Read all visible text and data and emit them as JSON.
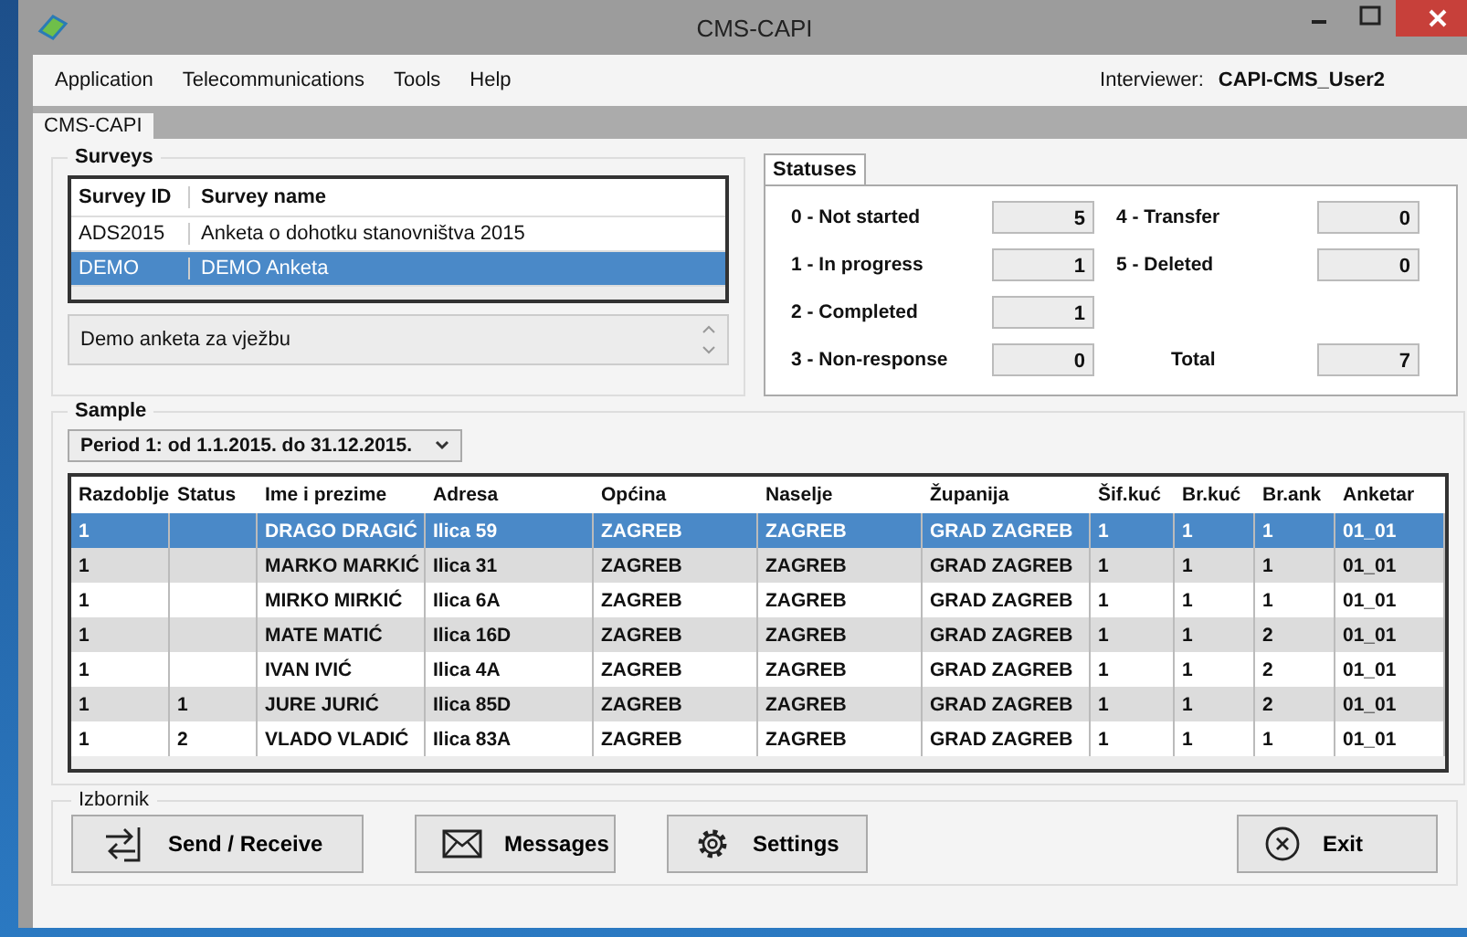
{
  "window": {
    "title": "CMS-CAPI"
  },
  "menu": [
    "Application",
    "Telecommunications",
    "Tools",
    "Help"
  ],
  "interviewer": {
    "label": "Interviewer:",
    "value": "CAPI-CMS_User2"
  },
  "tabs": [
    {
      "label": "CMS-CAPI",
      "selected": true
    }
  ],
  "surveys": {
    "title": "Surveys",
    "columns": [
      "Survey ID",
      "Survey name"
    ],
    "rows": [
      {
        "id": "ADS2015",
        "name": "Anketa o dohotku stanovništva 2015",
        "selected": false
      },
      {
        "id": "DEMO",
        "name": "DEMO Anketa",
        "selected": true
      }
    ],
    "description": "Demo anketa za vježbu"
  },
  "statuses": {
    "tab": "Statuses",
    "items": [
      {
        "label": "0 - Not started",
        "value": "5"
      },
      {
        "label": "4 - Transfer",
        "value": "0"
      },
      {
        "label": "1 - In progress",
        "value": "1"
      },
      {
        "label": "5 - Deleted",
        "value": "0"
      },
      {
        "label": "2 - Completed",
        "value": "1"
      },
      {
        "kind": "blank"
      },
      {
        "label": "3 - Non-response",
        "value": "0"
      },
      {
        "label": "Total",
        "value": "7",
        "kind": "total"
      }
    ]
  },
  "sample": {
    "title": "Sample",
    "period": "Period 1:  od 1.1.2015. do 31.12.2015.",
    "columns": [
      "Razdoblje",
      "Status",
      "Ime i prezime",
      "Adresa",
      "Općina",
      "Naselje",
      "Županija",
      "Šif.kuć",
      "Br.kuć",
      "Br.ank",
      "Anketar"
    ],
    "rows": [
      {
        "cells": [
          "1",
          "",
          "DRAGO DRAGIĆ",
          "Ilica 59",
          "ZAGREB",
          "ZAGREB",
          "GRAD ZAGREB",
          "1",
          "1",
          "1",
          "01_01"
        ],
        "selected": true
      },
      {
        "cells": [
          "1",
          "",
          "MARKO MARKIĆ",
          "Ilica 31",
          "ZAGREB",
          "ZAGREB",
          "GRAD ZAGREB",
          "1",
          "1",
          "1",
          "01_01"
        ],
        "selected": false
      },
      {
        "cells": [
          "1",
          "",
          "MIRKO MIRKIĆ",
          "Ilica 6A",
          "ZAGREB",
          "ZAGREB",
          "GRAD ZAGREB",
          "1",
          "1",
          "1",
          "01_01"
        ],
        "selected": false
      },
      {
        "cells": [
          "1",
          "",
          "MATE MATIĆ",
          "Ilica 16D",
          "ZAGREB",
          "ZAGREB",
          "GRAD ZAGREB",
          "1",
          "1",
          "2",
          "01_01"
        ],
        "selected": false
      },
      {
        "cells": [
          "1",
          "",
          "IVAN IVIĆ",
          "Ilica 4A",
          "ZAGREB",
          "ZAGREB",
          "GRAD ZAGREB",
          "1",
          "1",
          "2",
          "01_01"
        ],
        "selected": false
      },
      {
        "cells": [
          "1",
          "1",
          "JURE JURIĆ",
          "Ilica 85D",
          "ZAGREB",
          "ZAGREB",
          "GRAD ZAGREB",
          "1",
          "1",
          "2",
          "01_01"
        ],
        "selected": false
      },
      {
        "cells": [
          "1",
          "2",
          "VLADO VLADIĆ",
          "Ilica 83A",
          "ZAGREB",
          "ZAGREB",
          "GRAD ZAGREB",
          "1",
          "1",
          "1",
          "01_01"
        ],
        "selected": false
      }
    ]
  },
  "menu_panel": {
    "title": "Izbornik",
    "buttons": [
      {
        "label": "Send / Receive",
        "kind": "send"
      },
      {
        "label": "Messages",
        "kind": "messages"
      },
      {
        "label": "Settings",
        "kind": "settings"
      },
      {
        "label": "Exit",
        "kind": "exit"
      }
    ]
  }
}
